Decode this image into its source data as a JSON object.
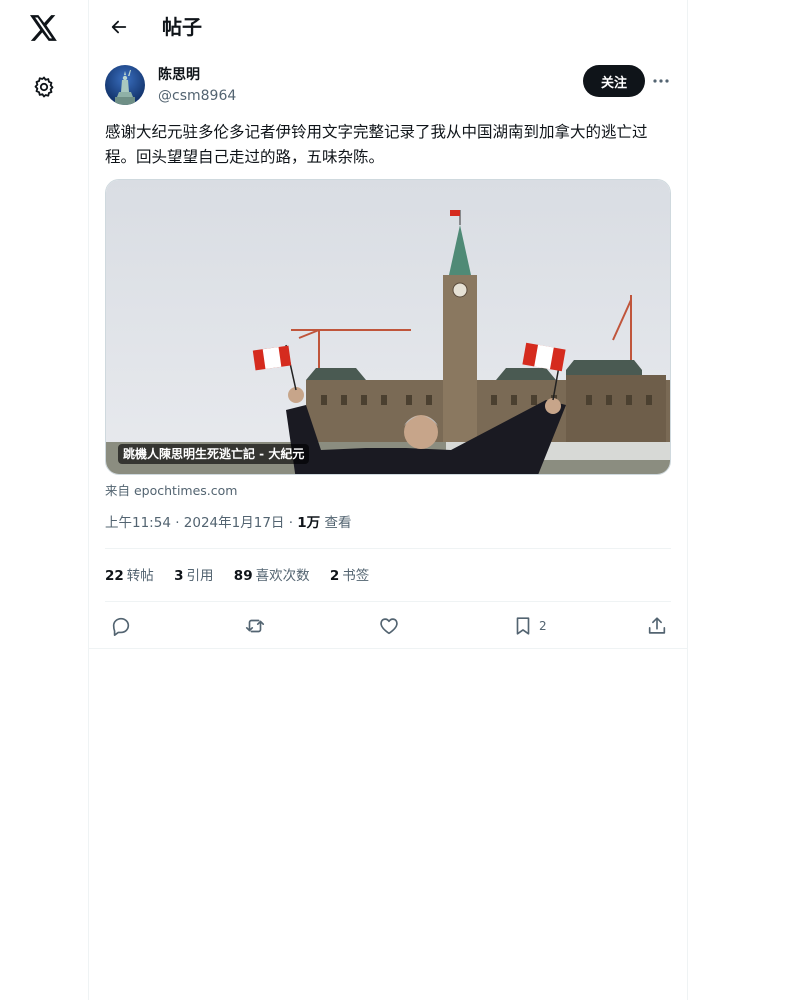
{
  "rail": {
    "logo_icon": "x-logo-icon",
    "settings_icon": "gear-icon"
  },
  "header": {
    "title": "帖子",
    "back_icon": "arrow-left-icon"
  },
  "author": {
    "name": "陈思明",
    "handle": "@csm8964",
    "follow_label": "关注",
    "more_icon": "more-horizontal-icon"
  },
  "tweet": {
    "text": "感谢大纪元驻多伦多记者伊铃用文字完整记录了我从中国湖南到加拿大的逃亡过程。回头望望自己走过的路，五味杂陈。"
  },
  "card": {
    "caption": "跳機人陳思明生死逃亡記 - 大紀元",
    "source": "来自 epochtimes.com"
  },
  "meta": {
    "time": "上午11:54",
    "sep1": " · ",
    "date": "2024年1月17日",
    "sep2": " · ",
    "views_count": "1万",
    "views_label": " 查看"
  },
  "stats": [
    {
      "count": "22",
      "label": "转帖"
    },
    {
      "count": "3",
      "label": "引用"
    },
    {
      "count": "89",
      "label": "喜欢次数"
    },
    {
      "count": "2",
      "label": "书签"
    }
  ],
  "actions": {
    "reply_icon": "reply-icon",
    "repost_icon": "repost-icon",
    "like_icon": "heart-icon",
    "bookmark_icon": "bookmark-icon",
    "bookmark_count": "2",
    "share_icon": "share-icon"
  },
  "colors": {
    "text": "#0f1419",
    "secondary": "#536471",
    "border": "#eff3f4",
    "button": "#0f1419"
  }
}
